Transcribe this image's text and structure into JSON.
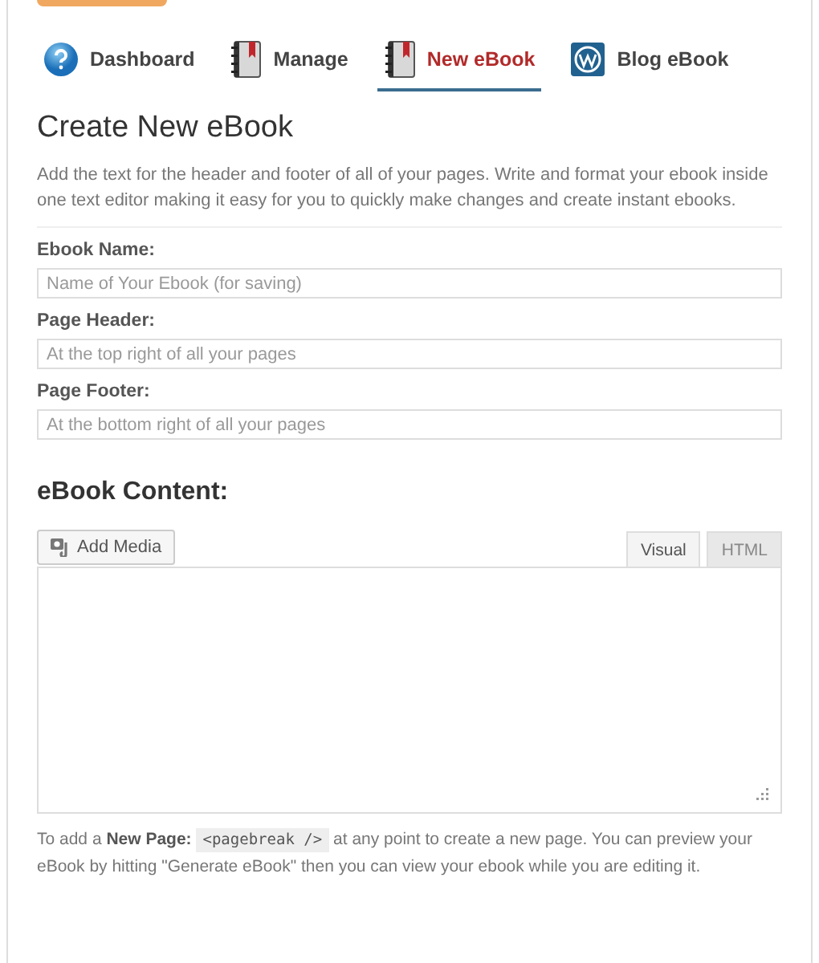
{
  "nav_tabs": [
    {
      "label": "Dashboard",
      "kind": "help",
      "selected": false
    },
    {
      "label": "Manage",
      "kind": "notebook",
      "selected": false
    },
    {
      "label": "New eBook",
      "kind": "notebook",
      "selected": true
    },
    {
      "label": "Blog eBook",
      "kind": "logo",
      "selected": false
    }
  ],
  "heading": "Create New eBook",
  "intro": "Add the text for the header and footer of all of your pages. Write and format your ebook inside one text editor making it easy for you to quickly make changes and create instant ebooks.",
  "fields": [
    {
      "label": "Ebook Name:",
      "placeholder": "Name of Your Ebook (for saving)"
    },
    {
      "label": "Page Header:",
      "placeholder": "At the top right of all your pages"
    },
    {
      "label": "Page Footer:",
      "placeholder": "At the bottom right of all your pages"
    }
  ],
  "content_heading": "eBook Content:",
  "add_media": "Add Media",
  "editor_tabs": [
    {
      "label": "Visual",
      "selected": true
    },
    {
      "label": "HTML",
      "selected": false
    }
  ],
  "help": {
    "before": "To add a **New Page:**",
    "code": "<pagebreak />",
    "after": "at any point to create a new page. You can preview your eBook by hitting \"Generate eBook\" then you can view your ebook while you are editing it."
  }
}
